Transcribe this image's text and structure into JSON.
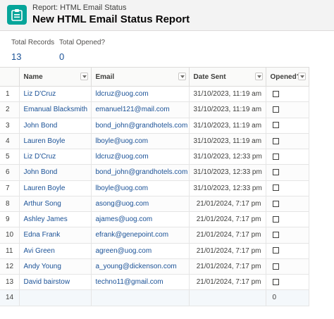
{
  "header": {
    "eyebrow": "Report: HTML Email Status",
    "title": "New HTML Email Status Report",
    "icon_color": "#06a59a",
    "icon": "report-icon"
  },
  "summary": [
    {
      "label": "Total Records",
      "value": "13"
    },
    {
      "label": "Total Opened?",
      "value": "0"
    }
  ],
  "table": {
    "columns": [
      "Name",
      "Email",
      "Date Sent",
      "Opened?"
    ],
    "rows": [
      {
        "num": "1",
        "name": "Liz D'Cruz",
        "email": "ldcruz@uog.com",
        "date": "31/10/2023, 11:19 am"
      },
      {
        "num": "2",
        "name": "Emanual Blacksmith",
        "email": "emanuel121@mail.com",
        "date": "31/10/2023, 11:19 am"
      },
      {
        "num": "3",
        "name": "John Bond",
        "email": "bond_john@grandhotels.com",
        "date": "31/10/2023, 11:19 am"
      },
      {
        "num": "4",
        "name": "Lauren Boyle",
        "email": "lboyle@uog.com",
        "date": "31/10/2023, 11:19 am"
      },
      {
        "num": "5",
        "name": "Liz D'Cruz",
        "email": "ldcruz@uog.com",
        "date": "31/10/2023, 12:33 pm"
      },
      {
        "num": "6",
        "name": "John Bond",
        "email": "bond_john@grandhotels.com",
        "date": "31/10/2023, 12:33 pm"
      },
      {
        "num": "7",
        "name": "Lauren Boyle",
        "email": "lboyle@uog.com",
        "date": "31/10/2023, 12:33 pm"
      },
      {
        "num": "8",
        "name": "Arthur Song",
        "email": "asong@uog.com",
        "date": "21/01/2024, 7:17 pm"
      },
      {
        "num": "9",
        "name": "Ashley James",
        "email": "ajames@uog.com",
        "date": "21/01/2024, 7:17 pm"
      },
      {
        "num": "10",
        "name": "Edna Frank",
        "email": "efrank@genepoint.com",
        "date": "21/01/2024, 7:17 pm"
      },
      {
        "num": "11",
        "name": "Avi Green",
        "email": "agreen@uog.com",
        "date": "21/01/2024, 7:17 pm"
      },
      {
        "num": "12",
        "name": "Andy Young",
        "email": "a_young@dickenson.com",
        "date": "21/01/2024, 7:17 pm"
      },
      {
        "num": "13",
        "name": "David bairstow",
        "email": "techno11@gmail.com",
        "date": "21/01/2024, 7:17 pm"
      }
    ],
    "total_row": {
      "num": "14",
      "opened_total": "0"
    }
  }
}
